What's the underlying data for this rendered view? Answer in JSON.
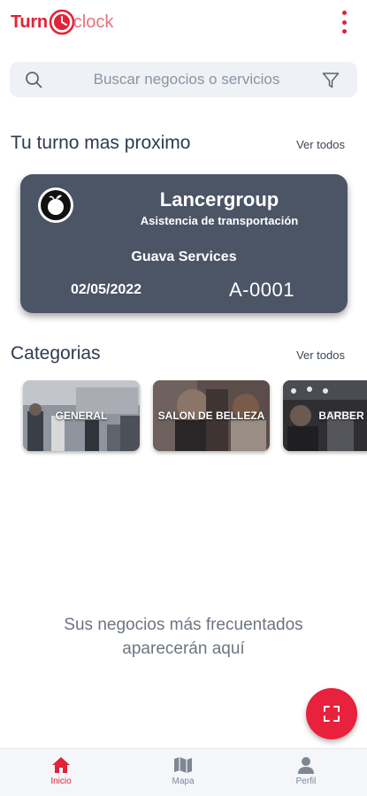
{
  "app": {
    "logo_turn": "Turn",
    "logo_clock": "clock",
    "brand_color": "#e22236"
  },
  "search": {
    "placeholder": "Buscar negocios o servicios",
    "value": ""
  },
  "next_turn": {
    "section_title": "Tu turno mas proximo",
    "see_all": "Ver todos",
    "business_name": "Lancergroup",
    "service": "Asistencia de transportación",
    "provider": "Guava Services",
    "date": "02/05/2022",
    "code": "A-0001",
    "logo_icon": "guava-logo-icon"
  },
  "categories": {
    "section_title": "Categorias",
    "see_all": "Ver todos",
    "items": [
      {
        "label": "GENERAL"
      },
      {
        "label": "SALON DE BELLEZA"
      },
      {
        "label": "BARBER"
      }
    ]
  },
  "frequent": {
    "empty_message": "Sus negocios más frecuentados aparecerán aquí"
  },
  "fab": {
    "icon": "scan-icon"
  },
  "bottom_nav": {
    "items": [
      {
        "label": "Inicio",
        "icon": "home-icon",
        "active": true
      },
      {
        "label": "Mapa",
        "icon": "map-icon",
        "active": false
      },
      {
        "label": "Perfil",
        "icon": "user-icon",
        "active": false
      }
    ]
  }
}
